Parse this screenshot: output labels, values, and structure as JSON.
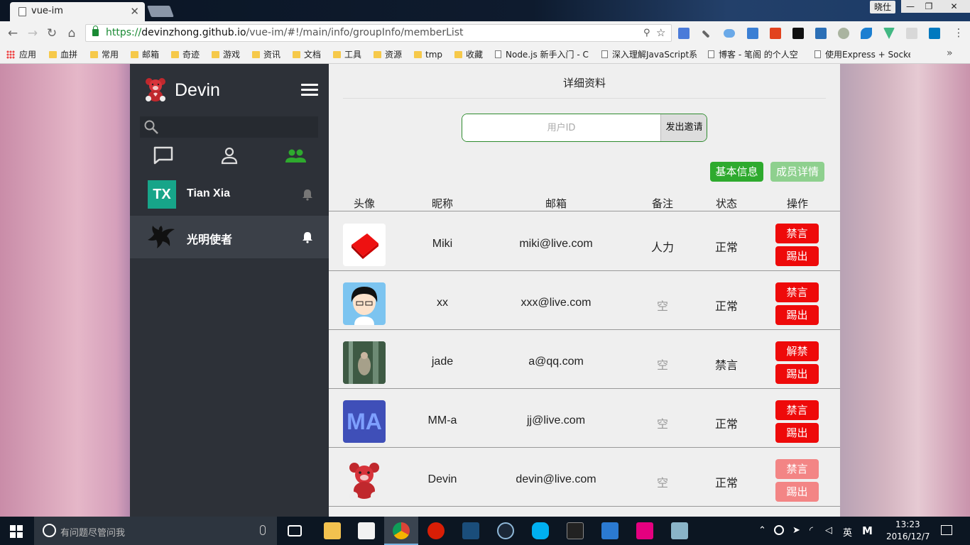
{
  "browser": {
    "tab_title": "vue-im",
    "tab_close": "✕",
    "user_name": "晓仕",
    "window_min": "—",
    "window_max": "❐",
    "window_close": "✕",
    "url_scheme": "https://",
    "url_host": "devinzhong.github.io",
    "url_path": "/vue-im/#!/main/info/groupInfo/memberList",
    "back": "←",
    "forward": "→",
    "reload": "↻",
    "home": "⌂",
    "key_icon": "⚲",
    "star_icon": "☆",
    "menu_icon": "⋮",
    "bookmarks_more": "»",
    "bookmarks": [
      {
        "label": "应用",
        "icon": "apps-icon"
      },
      {
        "label": "血拼",
        "icon": "folder-icon"
      },
      {
        "label": "常用",
        "icon": "folder-icon"
      },
      {
        "label": "邮箱",
        "icon": "folder-icon"
      },
      {
        "label": "奇迹",
        "icon": "folder-icon"
      },
      {
        "label": "游戏",
        "icon": "folder-icon"
      },
      {
        "label": "资讯",
        "icon": "folder-icon"
      },
      {
        "label": "文档",
        "icon": "folder-icon"
      },
      {
        "label": "工具",
        "icon": "folder-icon"
      },
      {
        "label": "资源",
        "icon": "folder-icon"
      },
      {
        "label": "tmp",
        "icon": "folder-icon"
      },
      {
        "label": "收藏",
        "icon": "folder-icon"
      },
      {
        "label": "Node.js 新手入门 - C",
        "icon": "page-icon"
      },
      {
        "label": "深入理解JavaScript系",
        "icon": "page-icon"
      },
      {
        "label": "博客 - 笔阁 的个人空",
        "icon": "page-icon"
      },
      {
        "label": "使用Express + Socke",
        "icon": "page-icon"
      }
    ]
  },
  "sidebar": {
    "brand": "Devin",
    "search_placeholder": "",
    "tabs": [
      {
        "name": "messages",
        "icon": "chat-icon",
        "active": false
      },
      {
        "name": "contacts",
        "icon": "person-icon",
        "active": false
      },
      {
        "name": "groups",
        "icon": "group-icon",
        "active": true
      }
    ],
    "contacts": [
      {
        "name": "Tian Xia",
        "avatar_text": "TX",
        "active": false
      },
      {
        "name": "光明使者",
        "avatar_text": "",
        "active": true
      }
    ]
  },
  "main": {
    "title": "详细资料",
    "invite_placeholder": "用户ID",
    "invite_value": "",
    "invite_button": "发出邀请",
    "tab_basic": "基本信息",
    "tab_members": "成员详情",
    "columns": [
      "头像",
      "昵称",
      "邮箱",
      "备注",
      "状态",
      "操作"
    ],
    "members": [
      {
        "nickname": "Miki",
        "email": "miki@live.com",
        "remark": "人力",
        "status": "正常",
        "action1": "禁言",
        "action2": "踢出",
        "avatar_text": "",
        "remark_empty": false,
        "disabled": false
      },
      {
        "nickname": "xx",
        "email": "xxx@live.com",
        "remark": "空",
        "status": "正常",
        "action1": "禁言",
        "action2": "踢出",
        "avatar_text": "",
        "remark_empty": true,
        "disabled": false
      },
      {
        "nickname": "jade",
        "email": "a@qq.com",
        "remark": "空",
        "status": "禁言",
        "action1": "解禁",
        "action2": "踢出",
        "avatar_text": "",
        "remark_empty": true,
        "disabled": false
      },
      {
        "nickname": "MM-a",
        "email": "jj@live.com",
        "remark": "空",
        "status": "正常",
        "action1": "禁言",
        "action2": "踢出",
        "avatar_text": "MA",
        "remark_empty": true,
        "disabled": false
      },
      {
        "nickname": "Devin",
        "email": "devin@live.com",
        "remark": "空",
        "status": "正常",
        "action1": "禁言",
        "action2": "踢出",
        "avatar_text": "",
        "remark_empty": true,
        "disabled": true
      }
    ]
  },
  "taskbar": {
    "search_placeholder": "有问题尽管问我",
    "ime": "英",
    "ime2": "M",
    "time": "13:23",
    "date": "2016/12/7"
  },
  "colors": {
    "accent_green": "#2eaa2e",
    "danger_red": "#ee0a0a",
    "sidebar_bg": "#2d3138",
    "teal_avatar": "#17a589"
  }
}
